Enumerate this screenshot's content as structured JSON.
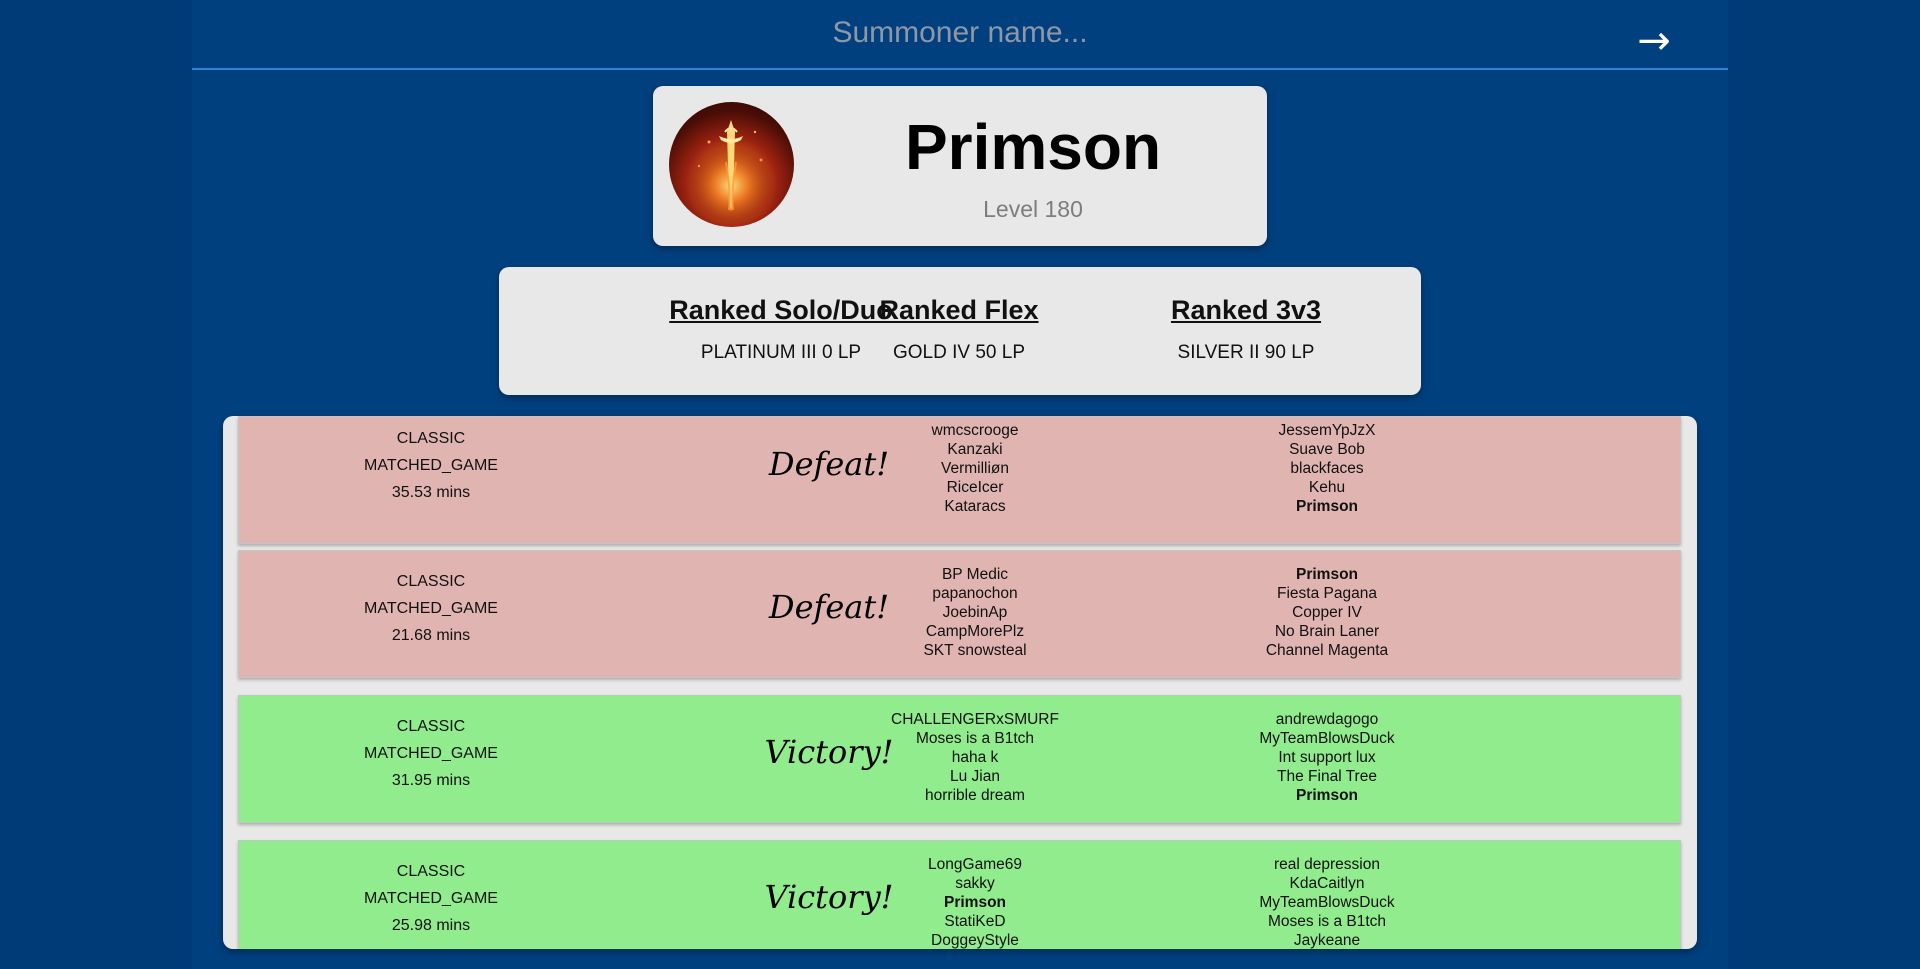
{
  "search": {
    "placeholder": "Summoner name...",
    "submit_icon": "→"
  },
  "profile": {
    "name": "Primson",
    "level": "Level 180",
    "avatar_icon": "flaming-sword-icon"
  },
  "ranked": [
    {
      "queue": "Ranked Solo/Duo",
      "rank": "PLATINUM III 0 LP"
    },
    {
      "queue": "Ranked Flex",
      "rank": "GOLD IV 50 LP"
    },
    {
      "queue": "Ranked 3v3",
      "rank": "SILVER II 90 LP"
    }
  ],
  "matches": [
    {
      "mode": "CLASSIC",
      "type": "MATCHED_GAME",
      "duration": "35.53 mins",
      "result": "Defeat!",
      "team1": [
        "wmcscrooge",
        "Kanzaki",
        "Vermilliøn",
        "RiceIcer",
        "Kataracs"
      ],
      "team2": [
        "JessemYpJzX",
        "Suave Bob",
        "blackfaces",
        "Kehu",
        "Primson"
      ]
    },
    {
      "mode": "CLASSIC",
      "type": "MATCHED_GAME",
      "duration": "21.68 mins",
      "result": "Defeat!",
      "team1": [
        "BP Medic",
        "papanochon",
        "JoebinAp",
        "CampMorePlz",
        "SKT snowsteal"
      ],
      "team2": [
        "Primson",
        "Fiesta Pagana",
        "Copper IV",
        "No Brain Laner",
        "Channel Magenta"
      ]
    },
    {
      "mode": "CLASSIC",
      "type": "MATCHED_GAME",
      "duration": "31.95 mins",
      "result": "Victory!",
      "team1": [
        "CHALLENGERxSMURF",
        "Moses is a B1tch",
        "haha k",
        "Lu Jian",
        "horrible dream"
      ],
      "team2": [
        "andrewdagogo",
        "MyTeamBlowsDuck",
        "Int support lux",
        "The Final Tree",
        "Primson"
      ]
    },
    {
      "mode": "CLASSIC",
      "type": "MATCHED_GAME",
      "duration": "25.98 mins",
      "result": "Victory!",
      "team1": [
        "LongGame69",
        "sakky",
        "Primson",
        "StatiKeD",
        "DoggeyStyle"
      ],
      "team2": [
        "real depression",
        "KdaCaitlyn",
        "MyTeamBlowsDuck",
        "Moses is a B1tch",
        "Jaykeane"
      ]
    }
  ],
  "colors": {
    "background": "#00407f",
    "defeat": "#e0b4b1",
    "victory": "#90ec8c",
    "card": "#e8e8e8"
  }
}
